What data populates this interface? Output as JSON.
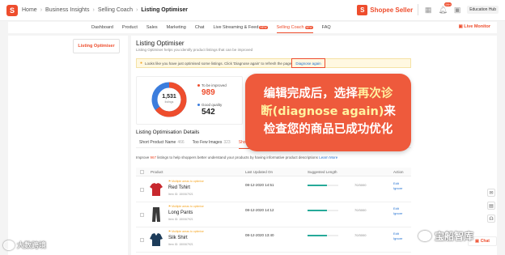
{
  "topbar": {
    "breadcrumbs": [
      "Home",
      "Business Insights",
      "Selling Coach",
      "Listing Optimiser"
    ],
    "brand": "Shopee Seller",
    "notif_count": "99+",
    "edu_hub": "Education Hub"
  },
  "nav": {
    "items": [
      "Dashboard",
      "Product",
      "Sales",
      "Marketing",
      "Chat",
      "Live Streaming & Feed",
      "Selling Coach",
      "FAQ"
    ],
    "new_tag": "NEW",
    "live_monitor": "Live Monitor"
  },
  "sidebar": {
    "active_item": "Listing Optimiser"
  },
  "main": {
    "title": "Listing Optimiser",
    "subtitle": "Listing Optimiser helps you identify product listings that can be improved",
    "banner_text": "Looks like you have just optimised some listings. Click 'Diagnose again' to refresh the page.",
    "diagnose_link": "Diagnose again",
    "donut": {
      "total": "1,531",
      "total_label": "listings",
      "to_improve_label": "To be improved",
      "to_improve_value": "989",
      "good_label": "Good quality",
      "good_value": "542",
      "colors": {
        "improve": "#ee4d2d",
        "good": "#3b7ddd"
      }
    },
    "details_title": "Listing Optimisation Details",
    "tabs": [
      {
        "label": "Short Product Name",
        "count": "466"
      },
      {
        "label": "Too Few Images",
        "count": "323"
      },
      {
        "label": "Short De",
        "count": ""
      }
    ],
    "improve_text_pre": "Improve",
    "improve_count": "967",
    "improve_text_post": "listings to help shoppers better understand your products by having informative product descriptions",
    "learn_more": "Learn More",
    "table": {
      "headers": [
        "Product",
        "Last Updated On",
        "Suggested Length",
        "Action"
      ],
      "rows": [
        {
          "flag": "Multiple areas to optimise",
          "name": "Red Tshirt",
          "id": "Item ID: 150067921",
          "date": "08-12-2020 14:51",
          "fraction": "70/3000",
          "progress": 0.62,
          "actions": [
            "Edit",
            "Ignore"
          ],
          "color": "#c8282e"
        },
        {
          "flag": "Multiple areas to optimise",
          "name": "Long Pants",
          "id": "Item ID: 150067921",
          "date": "08-12-2020 14:12",
          "fraction": "70/3000",
          "progress": 0.62,
          "actions": [
            "Edit",
            "Ignore"
          ],
          "color": "#3a3a3a"
        },
        {
          "flag": "Multiple areas to optimise",
          "name": "Silk Shirt",
          "id": "Item ID: 150067921",
          "date": "08-12-2020 13:40",
          "fraction": "70/3000",
          "progress": 0.62,
          "actions": [
            "Edit",
            "Ignore"
          ],
          "color": "#1d3c5a"
        }
      ]
    }
  },
  "overlay": {
    "line1": "编辑完成后，选择",
    "line1_highlight": "再次诊",
    "line2_highlight": "断(diagnose again)",
    "line2": "来",
    "line3": "检查您的商品已成功优化"
  },
  "widgets": {
    "chat": "Chat"
  },
  "watermarks": {
    "left": "大数跨境",
    "right": "宝船智库"
  }
}
